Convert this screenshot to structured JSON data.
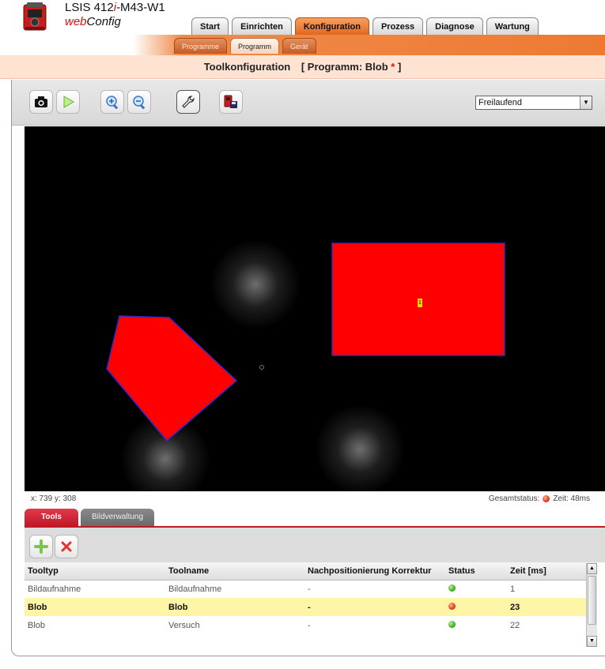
{
  "header": {
    "title_prefix": "LSIS 412",
    "title_italic": "i",
    "title_suffix": "-M43-W1",
    "subtitle_web": "web",
    "subtitle_config": "Config"
  },
  "main_tabs": [
    {
      "label": "Start",
      "active": false
    },
    {
      "label": "Einrichten",
      "active": false
    },
    {
      "label": "Konfiguration",
      "active": true
    },
    {
      "label": "Prozess",
      "active": false
    },
    {
      "label": "Diagnose",
      "active": false
    },
    {
      "label": "Wartung",
      "active": false
    }
  ],
  "sub_tabs": [
    {
      "label": "Programme",
      "active": false
    },
    {
      "label": "Programm",
      "active": true
    },
    {
      "label": "Gerät",
      "active": false
    }
  ],
  "page_title": {
    "label": "Toolkonfiguration",
    "program_prefix": "[ Programm: Blob ",
    "modified_mark": "*",
    "program_suffix": " ]"
  },
  "toolbar": {
    "trigger_mode": "Freilaufend",
    "dropdown_arrow": "▼"
  },
  "image": {
    "roi_label": "1"
  },
  "status": {
    "coords": "x: 739 y: 308",
    "gesamtstatus_label": "Gesamtstatus:",
    "zeit_label": "Zeit: 48ms",
    "overall_state_color": "#e2401a"
  },
  "bottom_tabs": [
    {
      "label": "Tools",
      "active": true
    },
    {
      "label": "Bildverwaltung",
      "active": false
    }
  ],
  "table": {
    "columns": [
      "Tooltyp",
      "Toolname",
      "Nachpositionierung Korrektur",
      "Status",
      "Zeit [ms]"
    ],
    "rows": [
      {
        "type": "Bildaufnahme",
        "name": "Bildaufnahme",
        "nachpos": "-",
        "status": "green",
        "zeit": "1",
        "selected": false
      },
      {
        "type": "Blob",
        "name": "Blob",
        "nachpos": "-",
        "status": "red",
        "zeit": "23",
        "selected": true
      },
      {
        "type": "Blob",
        "name": "Versuch",
        "nachpos": "-",
        "status": "green",
        "zeit": "22",
        "selected": false
      }
    ]
  },
  "colors": {
    "accent_orange": "#ee7a32",
    "title_bar_bg": "#ffe3d2",
    "roi_red": "#ff0000",
    "roi_outline": "#2a2acc",
    "selected_row": "#fff5a6",
    "tools_tab_red": "#c01828"
  }
}
